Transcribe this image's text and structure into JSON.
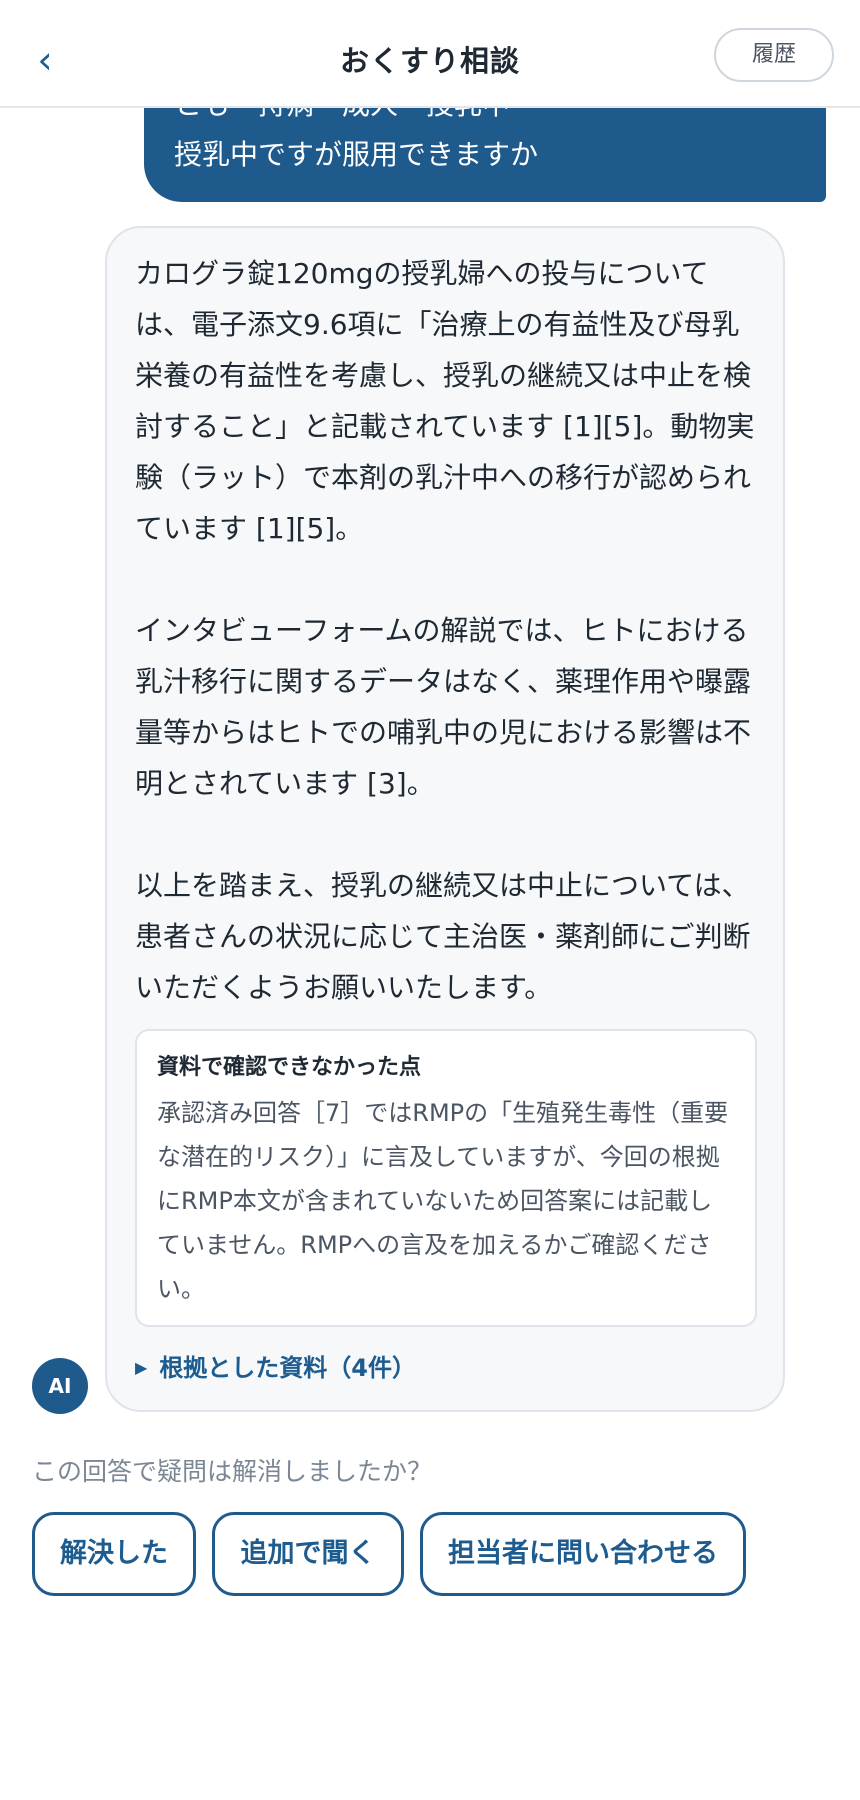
{
  "header": {
    "back_icon": "‹",
    "title": "おくすり相談",
    "history_label": "履歴"
  },
  "user_message": {
    "line1_partial": "とも・持病・成人・授乳中",
    "line2": "授乳中ですが服用できますか"
  },
  "ai_response": {
    "paragraphs": [
      "カログラ錠120mgの授乳婦への投与については、電子添文9.6項に「治療上の有益性及び母乳栄養の有益性を考慮し、授乳の継続又は中止を検討すること」と記載されています [1][5]。動物実験（ラット）で本剤の乳汁中への移行が認められています [1][5]。",
      "インタビューフォームの解説では、ヒトにおける乳汁移行に関するデータはなく、薬理作用や曝露量等からはヒトでの哺乳中の児における影響は不明とされています [3]。",
      "以上を踏まえ、授乳の継続又は中止については、患者さんの状況に応じて主治医・薬剤師にご判断いただくようお願いいたします。"
    ],
    "notice": {
      "title": "資料で確認できなかった点",
      "body": "承認済み回答［7］ではRMPの「生殖発生毒性（重要な潜在的リスク）」に言及していますが、今回の根拠にRMP本文が含まれていないため回答案には記載していません。RMPへの言及を加えるかご確認ください。"
    },
    "sources_icon": "▶",
    "sources_label": "根拠とした資料（4件）"
  },
  "avatar_label": "AI",
  "feedback": {
    "question": "この回答で疑問は解消しましたか？",
    "resolved": "解決した",
    "ask_more": "追加で聞く",
    "contact": "担当者に問い合わせる"
  },
  "colors": {
    "primary": "#1f5a8c",
    "card_bg": "#f6f8fa",
    "border": "#dfe4ea",
    "muted_text": "#7b8794"
  }
}
